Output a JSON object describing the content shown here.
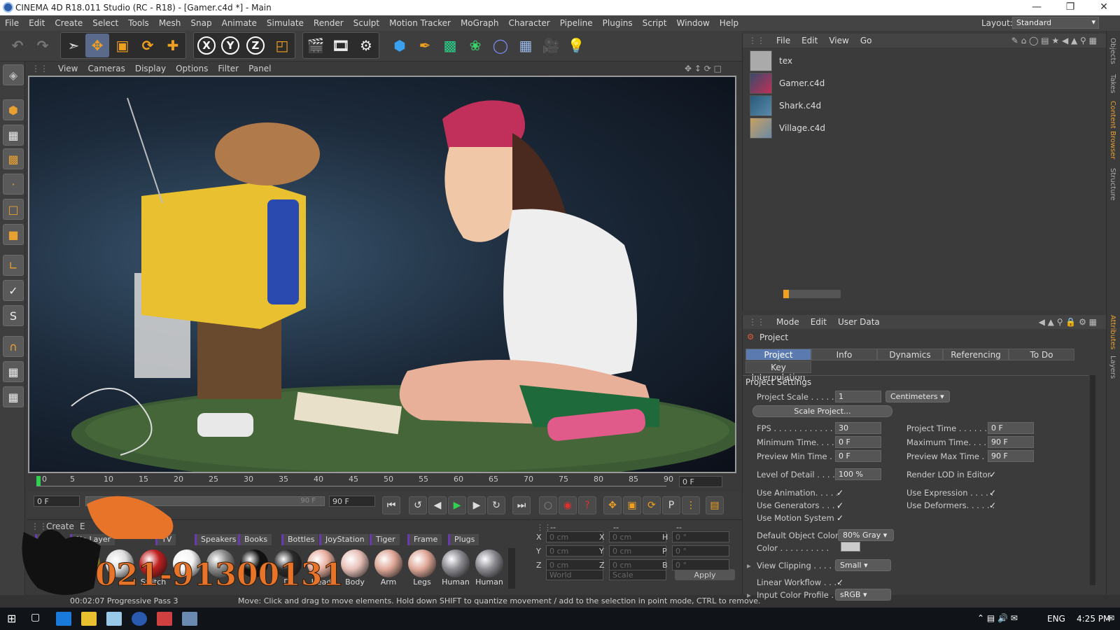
{
  "window": {
    "title": "CINEMA 4D R18.011 Studio (RC - R18) - [Gamer.c4d *] - Main"
  },
  "menu": [
    "File",
    "Edit",
    "Create",
    "Select",
    "Tools",
    "Mesh",
    "Snap",
    "Animate",
    "Simulate",
    "Render",
    "Sculpt",
    "Motion Tracker",
    "MoGraph",
    "Character",
    "Pipeline",
    "Plugins",
    "Script",
    "Window",
    "Help"
  ],
  "layout": {
    "label": "Layout:",
    "value": "Standard"
  },
  "toolbar": {
    "axis_x": "X",
    "axis_y": "Y",
    "axis_z": "Z"
  },
  "viewport": {
    "menu": [
      "View",
      "Cameras",
      "Display",
      "Options",
      "Filter",
      "Panel"
    ]
  },
  "timeline": {
    "ticks": [
      "0",
      "5",
      "10",
      "15",
      "20",
      "25",
      "30",
      "35",
      "40",
      "45",
      "50",
      "55",
      "60",
      "65",
      "70",
      "75",
      "80",
      "85",
      "90"
    ],
    "current": "0 F"
  },
  "transport": {
    "start": "0 F",
    "range_end": "90 F",
    "end": "90 F"
  },
  "materials": {
    "menu": [
      "Create",
      "E"
    ],
    "tabs": [
      "All",
      "No Layer",
      "TV",
      "Speakers",
      "Books",
      "Bottles",
      "JoyStation",
      "Tiger",
      "Frame",
      "Plugs"
    ],
    "balls": [
      {
        "name": "",
        "color": "#222"
      },
      {
        "name": "",
        "color": "#e0c030"
      },
      {
        "name": "",
        "color": "#ddd"
      },
      {
        "name": "Switch",
        "color": "#c02020"
      },
      {
        "name": "",
        "color": "#f4f4f4"
      },
      {
        "name": "",
        "color": "#8a8a8a"
      },
      {
        "name": "",
        "color": "#111"
      },
      {
        "name": "Di",
        "color": "#2a2a2a"
      },
      {
        "name": "Head",
        "color": "#e8b0a0"
      },
      {
        "name": "Body",
        "color": "#e8c0b8"
      },
      {
        "name": "Arm",
        "color": "#e0a898"
      },
      {
        "name": "Legs",
        "color": "#e0a898"
      },
      {
        "name": "Human",
        "color": "#8a8a90"
      },
      {
        "name": "Human",
        "color": "#8a8a90"
      }
    ]
  },
  "coords": {
    "header": [
      "--",
      "--",
      "--"
    ],
    "rows": [
      {
        "a": "X",
        "av": "0 cm",
        "b": "X",
        "bv": "0 cm",
        "c": "H",
        "cv": "0 °"
      },
      {
        "a": "Y",
        "av": "0 cm",
        "b": "Y",
        "bv": "0 cm",
        "c": "P",
        "cv": "0 °"
      },
      {
        "a": "Z",
        "av": "0 cm",
        "b": "Z",
        "bv": "0 cm",
        "c": "B",
        "cv": "0 °"
      }
    ],
    "mode": "World",
    "scale": "Scale",
    "apply": "Apply"
  },
  "status": {
    "left": "00:02:07 Progressive Pass 3",
    "message": "Move: Click and drag to move elements. Hold down SHIFT to quantize movement / add to the selection in point mode, CTRL to remove."
  },
  "content_browser": {
    "menu": [
      "File",
      "Edit",
      "View",
      "Go"
    ],
    "items": [
      "tex",
      "Gamer.c4d",
      "Shark.c4d",
      "Village.c4d"
    ]
  },
  "attributes": {
    "menu": [
      "Mode",
      "Edit",
      "User Data"
    ],
    "object": "Project",
    "tabs": [
      "Project Settings",
      "Info",
      "Dynamics",
      "Referencing",
      "To Do"
    ],
    "tab2": "Key Interpolation",
    "section": "Project Settings",
    "project_scale": {
      "label": "Project Scale . . . . . .",
      "value": "1",
      "unit": "Centimeters"
    },
    "scale_btn": "Scale Project...",
    "fps": {
      "label": "FPS . . . . . . . . . . . . .",
      "value": "30"
    },
    "project_time": {
      "label": "Project Time . . . . . . . .",
      "value": "0 F"
    },
    "min_time": {
      "label": "Minimum Time. . . . .",
      "value": "0 F"
    },
    "max_time": {
      "label": "Maximum Time. . . . . .",
      "value": "90 F"
    },
    "prev_min": {
      "label": "Preview Min Time . .",
      "value": "0 F"
    },
    "prev_max": {
      "label": "Preview Max Time . . .",
      "value": "90 F"
    },
    "lod": {
      "label": "Level of Detail . . . . .",
      "value": "100 %"
    },
    "render_lod": "Render LOD in Editor",
    "use_anim": "Use Animation. . . . .",
    "use_expr": "Use Expression . . . . .",
    "use_gen": "Use Generators . . . .",
    "use_def": "Use Deformers. . . . . .",
    "use_motion": "Use Motion System",
    "def_color": {
      "label": "Default Object Color",
      "value": "80% Gray"
    },
    "color": {
      "label": "Color . . . . . . . . . ."
    },
    "view_clip": {
      "label": "View Clipping . . . . .",
      "value": "Small"
    },
    "linear": "Linear Workflow . . . .",
    "icp": {
      "label": "Input Color Profile . .",
      "value": "sRGB"
    }
  },
  "right_tabs": [
    "Objects",
    "Takes",
    "Content Browser",
    "Structure",
    "Attributes",
    "Layers"
  ],
  "taskbar": {
    "lang": "ENG",
    "time": "4:25 PM"
  },
  "watermark": {
    "phone": "021-91300131"
  },
  "colors": {
    "accent": "#5b7bb0",
    "viewport_bg": "#1c2a3a",
    "watermark_orange": "#e8742a"
  }
}
